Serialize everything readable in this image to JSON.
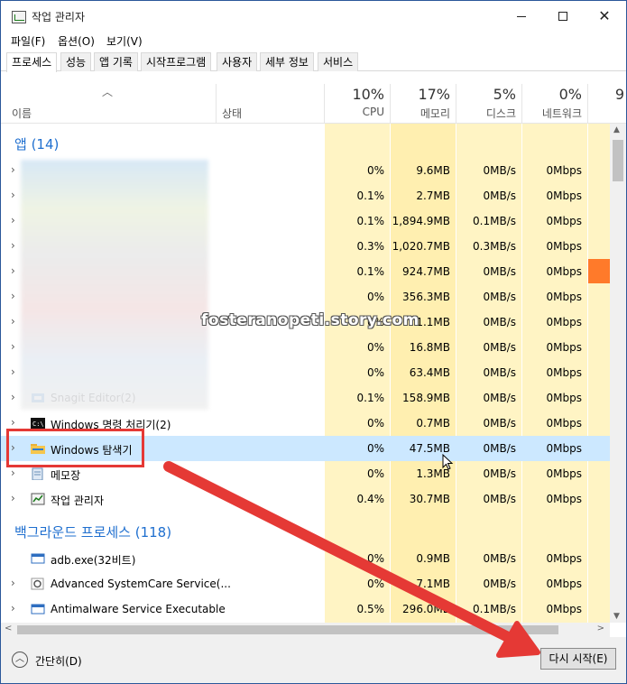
{
  "window": {
    "title": "작업 관리자",
    "minimize": "—",
    "close": "✕"
  },
  "menu": [
    "파일(F)",
    "옵션(O)",
    "보기(V)"
  ],
  "tabs": [
    "프로세스",
    "성능",
    "앱 기록",
    "시작프로그램",
    "사용자",
    "세부 정보",
    "서비스"
  ],
  "columns": {
    "name": "이름",
    "status": "상태",
    "cpu": {
      "pct": "10%",
      "label": "CPU"
    },
    "memory": {
      "pct": "17%",
      "label": "메모리"
    },
    "disk": {
      "pct": "5%",
      "label": "디스크"
    },
    "network": {
      "pct": "0%",
      "label": "네트워크"
    },
    "extra": "9"
  },
  "groups": {
    "apps": "앱 (14)",
    "background": "백그라운드 프로세스 (118)"
  },
  "app_rows": [
    {
      "name": "",
      "cpu": "0%",
      "mem": "9.6MB",
      "disk": "0MB/s",
      "net": "0Mbps"
    },
    {
      "name": "",
      "cpu": "0.1%",
      "mem": "2.7MB",
      "disk": "0MB/s",
      "net": "0Mbps"
    },
    {
      "name": "",
      "cpu": "0.1%",
      "mem": "1,894.9MB",
      "disk": "0.1MB/s",
      "net": "0Mbps"
    },
    {
      "name": "",
      "cpu": "0.3%",
      "mem": "1,020.7MB",
      "disk": "0.3MB/s",
      "net": "0Mbps"
    },
    {
      "name": "",
      "cpu": "0.1%",
      "mem": "924.7MB",
      "disk": "0MB/s",
      "net": "0Mbps"
    },
    {
      "name": "",
      "cpu": "0%",
      "mem": "356.3MB",
      "disk": "0MB/s",
      "net": "0Mbps"
    },
    {
      "name": "",
      "cpu": "0%",
      "mem": "1.1MB",
      "disk": "0MB/s",
      "net": "0Mbps"
    },
    {
      "name": "",
      "cpu": "0%",
      "mem": "16.8MB",
      "disk": "0MB/s",
      "net": "0Mbps"
    },
    {
      "name": "",
      "cpu": "0%",
      "mem": "63.4MB",
      "disk": "0MB/s",
      "net": "0Mbps"
    },
    {
      "name": "Snagit Editor(2)",
      "cpu": "0.1%",
      "mem": "158.9MB",
      "disk": "0MB/s",
      "net": "0Mbps"
    },
    {
      "name": "Windows 명령 처리기(2)",
      "cpu": "0%",
      "mem": "0.7MB",
      "disk": "0MB/s",
      "net": "0Mbps"
    },
    {
      "name": "Windows 탐색기",
      "cpu": "0%",
      "mem": "47.5MB",
      "disk": "0MB/s",
      "net": "0Mbps"
    },
    {
      "name": "메모장",
      "cpu": "0%",
      "mem": "1.3MB",
      "disk": "0MB/s",
      "net": "0Mbps"
    },
    {
      "name": "작업 관리자",
      "cpu": "0.4%",
      "mem": "30.7MB",
      "disk": "0MB/s",
      "net": "0Mbps"
    }
  ],
  "bg_rows": [
    {
      "name": "adb.exe(32비트)",
      "cpu": "0%",
      "mem": "0.9MB",
      "disk": "0MB/s",
      "net": "0Mbps"
    },
    {
      "name": "Advanced SystemCare Service(...",
      "cpu": "0%",
      "mem": "7.1MB",
      "disk": "0MB/s",
      "net": "0Mbps"
    },
    {
      "name": "Antimalware Service Executable",
      "cpu": "0.5%",
      "mem": "296.0MB",
      "disk": "0.1MB/s",
      "net": "0Mbps"
    }
  ],
  "footer": {
    "fewer_details": "간단히(D)",
    "restart": "다시 시작(E)"
  },
  "watermark": "fosteranopeti.story.com",
  "colors": {
    "accent": "#1f6fcf",
    "selected": "#cce8ff",
    "heat_light": "#fff4c4",
    "heat": "#ffefb0",
    "annotation": "#e53935",
    "net_spike": "#ff7a2a"
  }
}
